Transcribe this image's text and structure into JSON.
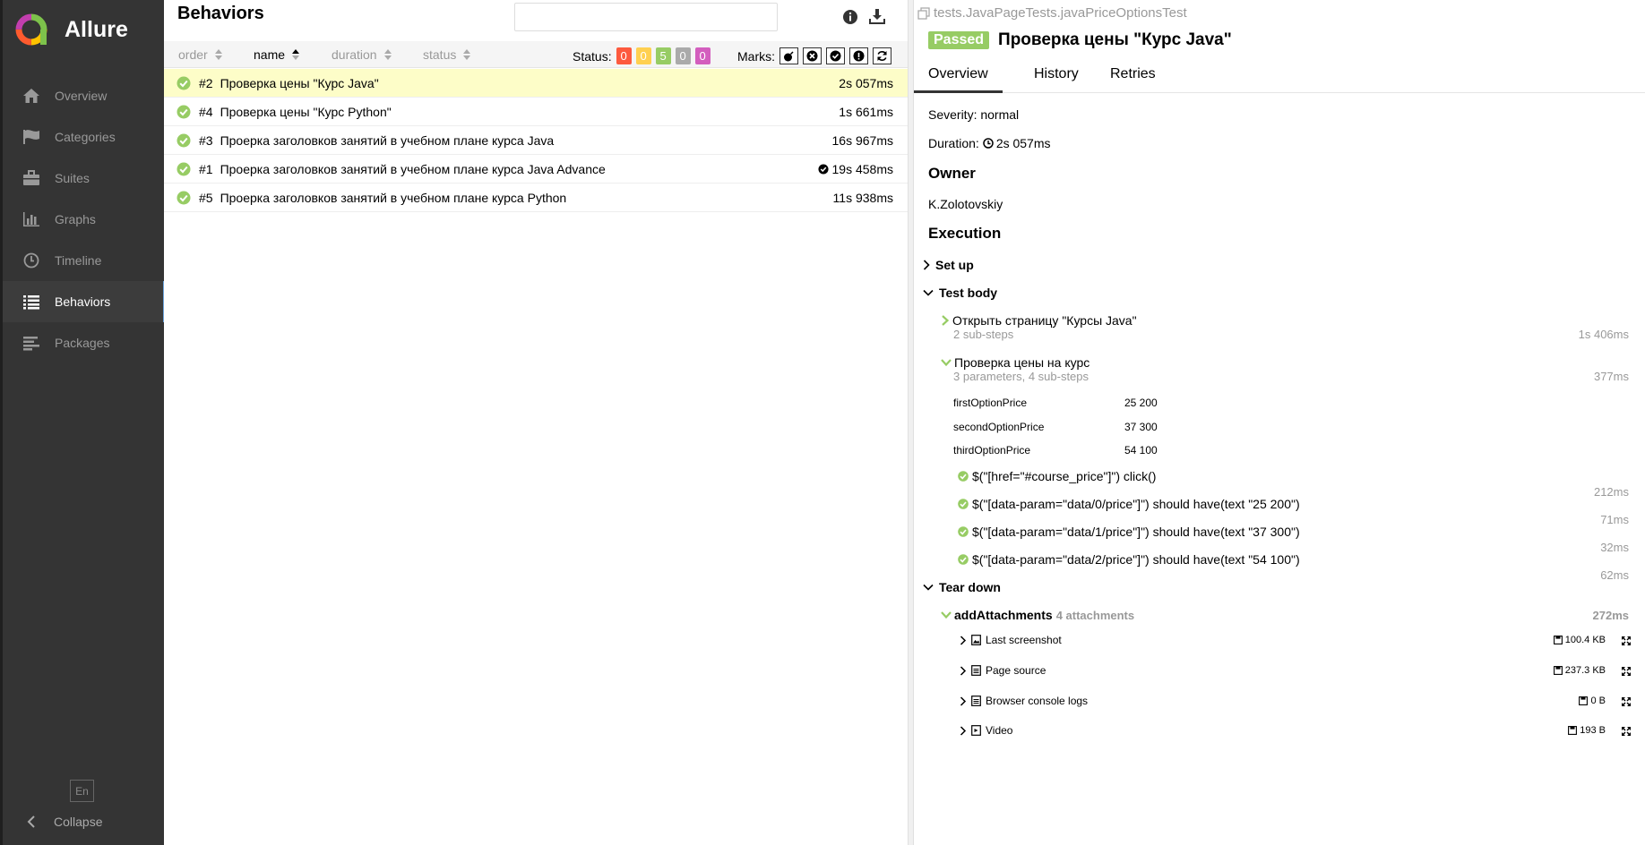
{
  "app": {
    "name": "Allure"
  },
  "nav": {
    "overview": "Overview",
    "categories": "Categories",
    "suites": "Suites",
    "graphs": "Graphs",
    "timeline": "Timeline",
    "behaviors": "Behaviors",
    "packages": "Packages",
    "language": "En",
    "collapse": "Collapse"
  },
  "list": {
    "title": "Behaviors",
    "search_value": "",
    "sort": {
      "order": "order",
      "name": "name",
      "duration": "duration",
      "status": "status"
    },
    "status_label": "Status:",
    "status_counts": [
      {
        "value": "0",
        "color": "#fd5a3e"
      },
      {
        "value": "0",
        "color": "#ffd050"
      },
      {
        "value": "5",
        "color": "#97cc64"
      },
      {
        "value": "0",
        "color": "#aaaaaa"
      },
      {
        "value": "0",
        "color": "#d35ebe"
      }
    ],
    "marks_label": "Marks:",
    "rows": [
      {
        "num": "#2",
        "name": "Проверка цены \"Курс Java\"",
        "duration": "2s 057ms"
      },
      {
        "num": "#4",
        "name": "Проверка цены \"Курс Python\"",
        "duration": "1s 661ms"
      },
      {
        "num": "#3",
        "name": "Проерка заголовков занятий в учебном плане курса Java",
        "duration": "16s 967ms"
      },
      {
        "num": "#1",
        "name": "Проерка заголовков занятий в учебном плане курса Java Advance",
        "duration": "19s 458ms"
      },
      {
        "num": "#5",
        "name": "Проерка заголовков занятий в учебном плане курса Python",
        "duration": "11s 938ms"
      }
    ]
  },
  "detail": {
    "breadcrumb": "tests.JavaPageTests.javaPriceOptionsTest",
    "status": "Passed",
    "title": "Проверка цены \"Курс Java\"",
    "tabs": {
      "overview": "Overview",
      "history": "History",
      "retries": "Retries"
    },
    "severity": "Severity: normal",
    "duration_label": "Duration:",
    "duration": "2s 057ms",
    "owner_heading": "Owner",
    "owner": "K.Zolotovskiy",
    "execution_heading": "Execution",
    "setup": "Set up",
    "test_body": "Test body",
    "step1": {
      "name": "Открыть страницу \"Курсы Java\"",
      "meta": "2 sub-steps",
      "time": "1s 406ms"
    },
    "step2": {
      "name": "Проверка цены на курс",
      "meta": "3 parameters, 4 sub-steps",
      "time": "377ms"
    },
    "params": [
      {
        "name": "firstOptionPrice",
        "value": "25 200"
      },
      {
        "name": "secondOptionPrice",
        "value": "37 300"
      },
      {
        "name": "thirdOptionPrice",
        "value": "54 100"
      }
    ],
    "substeps": [
      {
        "name": "$(\"[href=\"#course_price\"]\") click()",
        "time": "212ms"
      },
      {
        "name": "$(\"[data-param=\"data/0/price\"]\") should have(text \"25 200\")",
        "time": "71ms"
      },
      {
        "name": "$(\"[data-param=\"data/1/price\"]\") should have(text \"37 300\")",
        "time": "32ms"
      },
      {
        "name": "$(\"[data-param=\"data/2/price\"]\") should have(text \"54 100\")",
        "time": "62ms"
      }
    ],
    "teardown": "Tear down",
    "add_attachments": {
      "name": "addAttachments",
      "meta": "4 attachments",
      "time": "272ms"
    },
    "attachments": [
      {
        "name": "Last screenshot",
        "size": "100.4 KB"
      },
      {
        "name": "Page source",
        "size": "237.3 KB"
      },
      {
        "name": "Browser console logs",
        "size": "0 B"
      },
      {
        "name": "Video",
        "size": "193 B"
      }
    ]
  }
}
